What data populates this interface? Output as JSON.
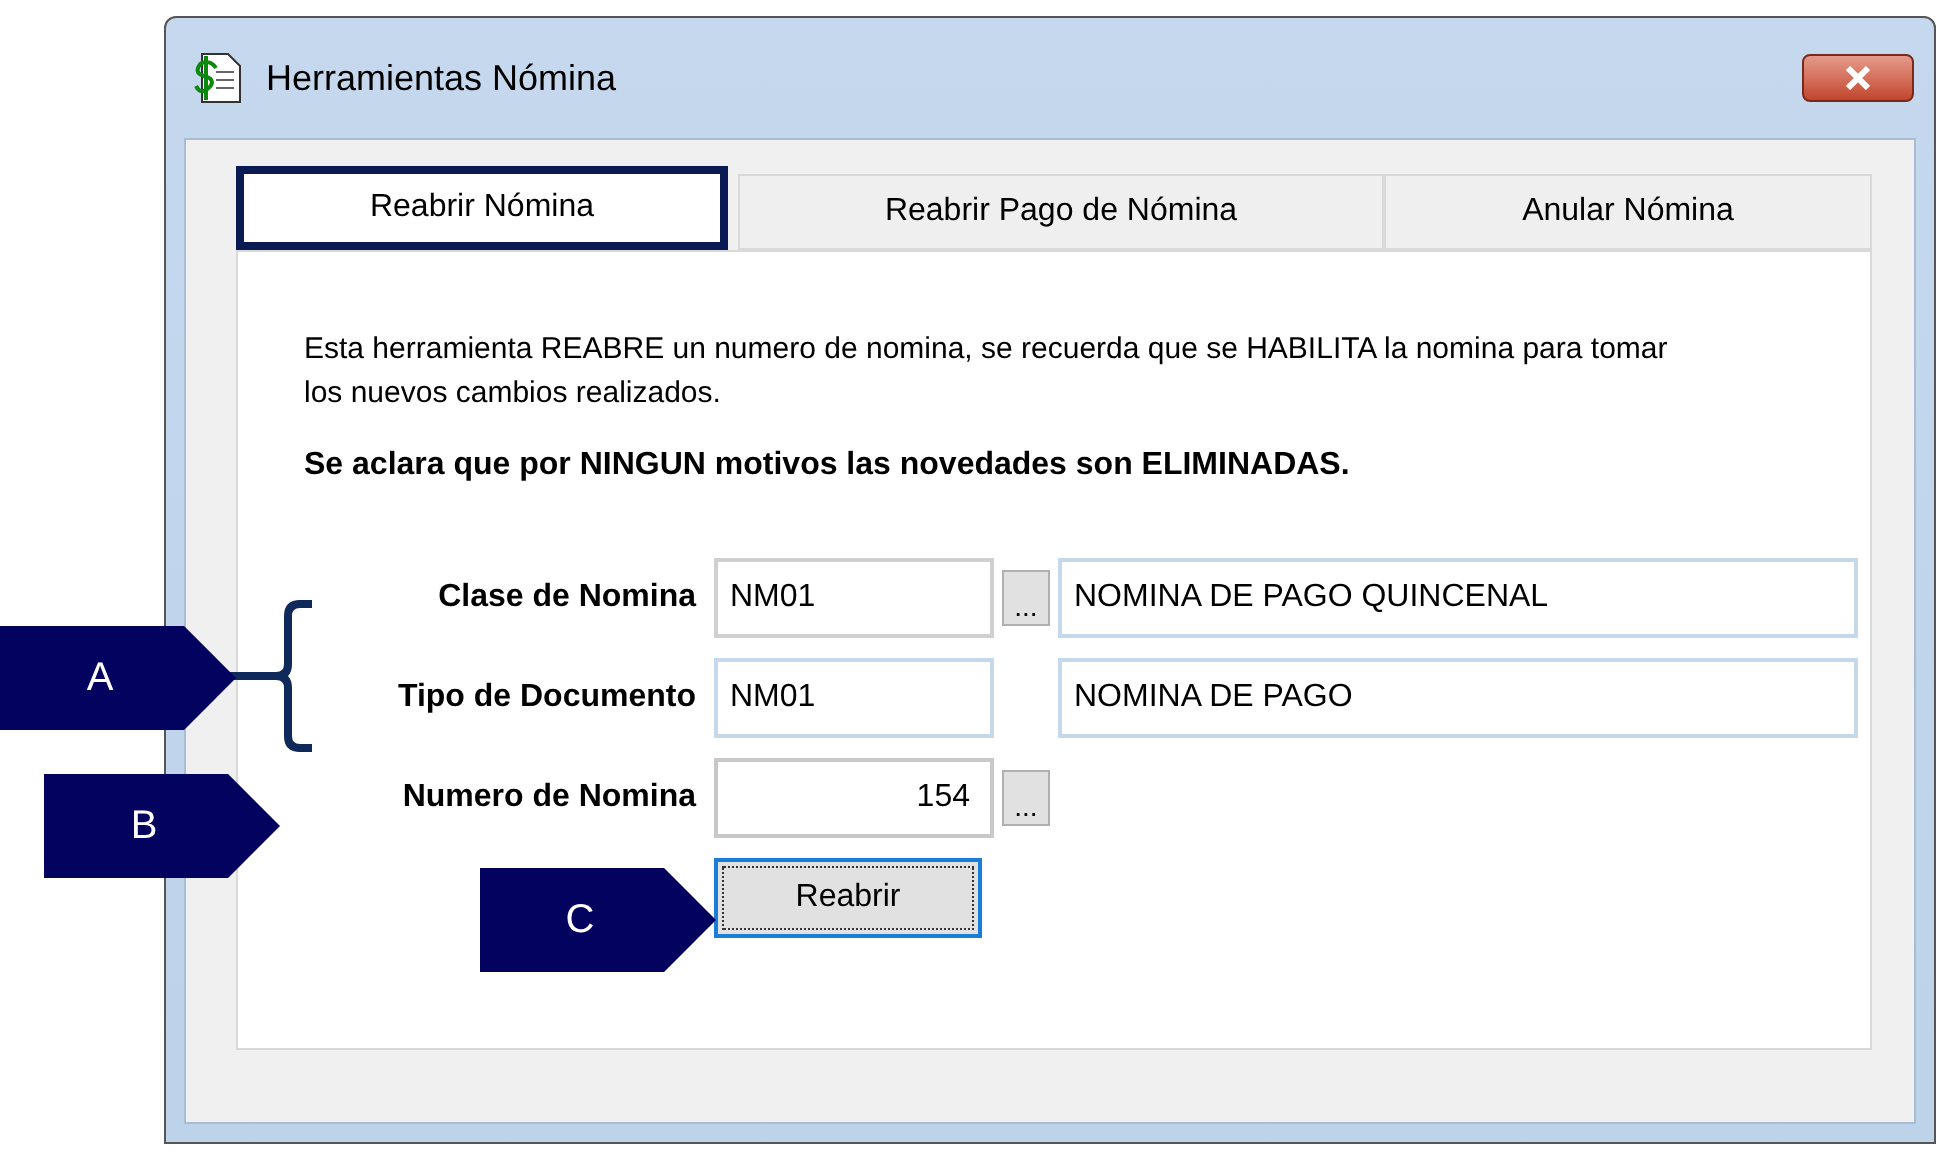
{
  "window": {
    "title": "Herramientas Nómina"
  },
  "tabs": [
    {
      "label": "Reabrir Nómina",
      "selected": true
    },
    {
      "label": "Reabrir Pago de Nómina",
      "selected": false
    },
    {
      "label": "Anular Nómina",
      "selected": false
    }
  ],
  "description": "Esta herramienta REABRE un numero de nomina, se recuerda que se HABILITA la nomina para tomar los nuevos cambios realizados.",
  "note": "Se aclara que por NINGUN motivos las novedades son ELIMINADAS.",
  "rows": [
    {
      "label": "Clase de Nomina",
      "kind": "code",
      "value": "NM01",
      "lookup": "...",
      "detail": "NOMINA DE PAGO QUINCENAL"
    },
    {
      "label": "Tipo de Documento",
      "kind": "code",
      "value": "NM01",
      "detail": "NOMINA DE PAGO"
    },
    {
      "label": "Numero de Nomina",
      "kind": "number",
      "value": "154",
      "lookup": "..."
    }
  ],
  "button": "Reabrir",
  "callouts": [
    "A",
    "B",
    "C"
  ]
}
